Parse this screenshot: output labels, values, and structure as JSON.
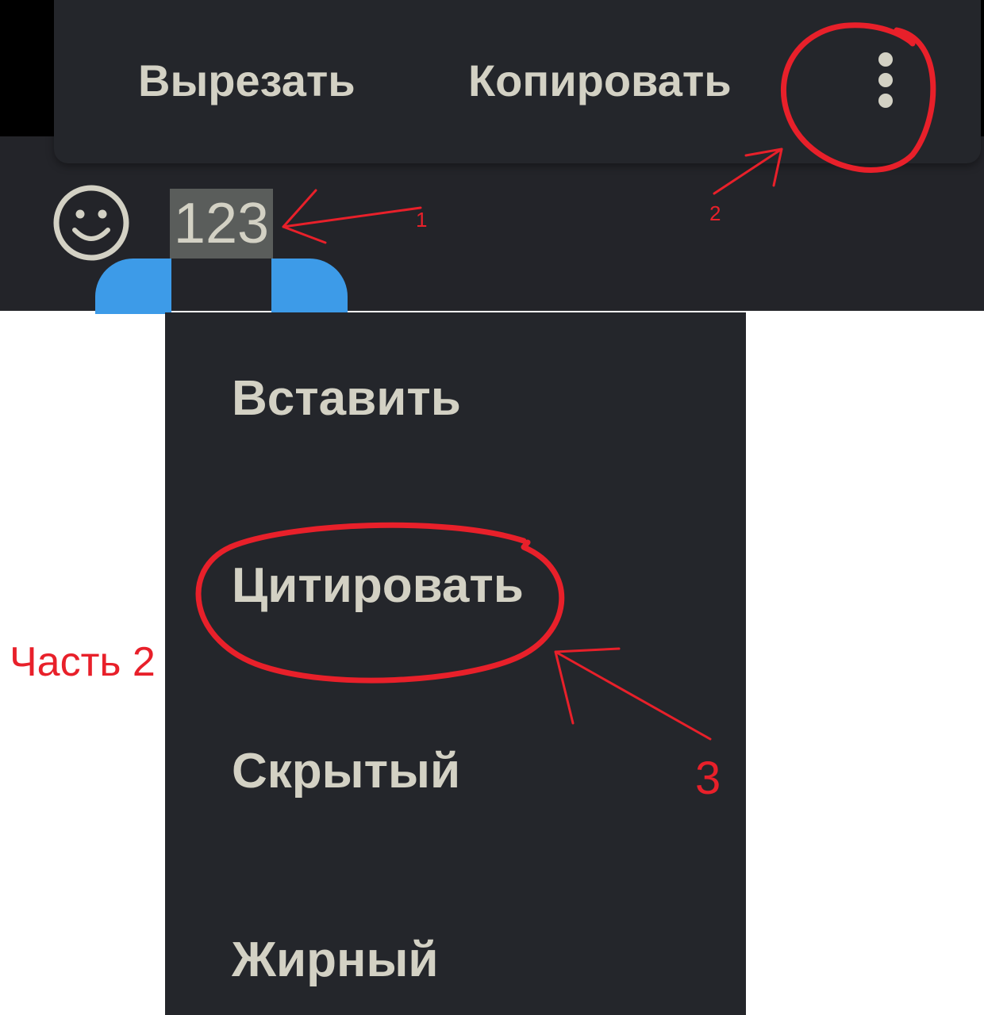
{
  "toolbar": {
    "cut_label": "Вырезать",
    "copy_label": "Копировать",
    "more_icon": "more-vertical-icon"
  },
  "input": {
    "emoji_icon": "smiley-icon",
    "selected_text": "123"
  },
  "menu": {
    "items": [
      {
        "label": "Вставить"
      },
      {
        "label": "Цитировать"
      },
      {
        "label": "Скрытый"
      },
      {
        "label": "Жирный"
      }
    ]
  },
  "annotations": {
    "part_label": "Часть 2",
    "marker_1": "1",
    "marker_2": "2",
    "marker_3": "3",
    "color": "#e8202a"
  },
  "colors": {
    "panel": "#24262b",
    "text": "#d3d1c4",
    "selection_handle": "#3d9be8",
    "selection_bg": "#5a5d5b"
  }
}
